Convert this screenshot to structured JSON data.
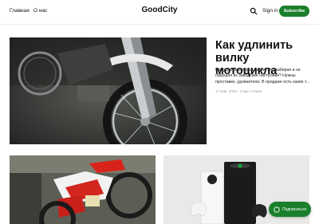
{
  "header": {
    "nav": [
      "Главная",
      "О нас"
    ],
    "brand": "GoodCity",
    "signin_label": "Sign in",
    "subscribe_label": "Subscribe"
  },
  "featured": {
    "title": "Как удлинить вилку мотоцикла",
    "excerpt": "Как удлинить перья вилки, не разбирая и не нарушая их заводские настройки? Нужны проставки, удлинители. В продаже есть какие т...",
    "meta": "17 мар. 2023 · 4 мин чтения"
  },
  "floating": {
    "subscribe_label": "Подписаться"
  },
  "colors": {
    "accent": "#1a7f2b"
  },
  "icons": {
    "search": "search-icon",
    "subscribe": "chat-bubble-icon"
  }
}
